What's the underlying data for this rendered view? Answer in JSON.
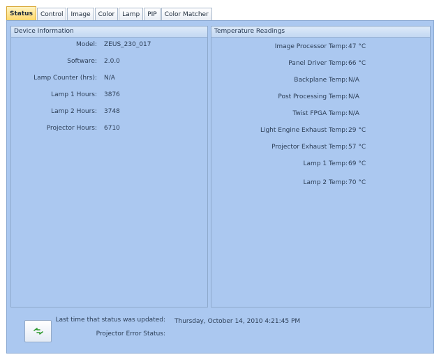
{
  "tabs": [
    {
      "label": "Status",
      "active": true
    },
    {
      "label": "Control",
      "active": false
    },
    {
      "label": "Image",
      "active": false
    },
    {
      "label": "Color",
      "active": false
    },
    {
      "label": "Lamp",
      "active": false
    },
    {
      "label": "PIP",
      "active": false
    },
    {
      "label": "Color Matcher",
      "active": false
    }
  ],
  "device_info": {
    "header": "Device Information",
    "rows": [
      {
        "label": "Model:",
        "value": "ZEUS_230_017"
      },
      {
        "label": "Software:",
        "value": "2.0.0"
      },
      {
        "label": "Lamp Counter (hrs):",
        "value": "N/A"
      },
      {
        "label": "Lamp 1 Hours:",
        "value": "3876"
      },
      {
        "label": "Lamp 2 Hours:",
        "value": "3748"
      },
      {
        "label": "Projector Hours:",
        "value": "6710"
      }
    ]
  },
  "temperature": {
    "header": "Temperature Readings",
    "rows": [
      {
        "label": "Image Processor Temp:",
        "value": "47 °C"
      },
      {
        "label": "Panel Driver Temp:",
        "value": "66 °C"
      },
      {
        "label": "Backplane Temp:",
        "value": "N/A"
      },
      {
        "label": "Post Processing Temp:",
        "value": "N/A"
      },
      {
        "label": "Twist FPGA Temp:",
        "value": "N/A"
      },
      {
        "label": "Light Engine Exhaust Temp:",
        "value": "29 °C"
      },
      {
        "label": "Projector Exhaust Temp:",
        "value": "57 °C"
      },
      {
        "label": "Lamp 1 Temp:",
        "value": "69 °C"
      },
      {
        "label": "Lamp 2 Temp:",
        "value": "70 °C"
      }
    ]
  },
  "footer": {
    "last_updated_label": "Last time that status was updated:",
    "last_updated_value": "Thursday, October 14, 2010 4:21:45 PM",
    "error_status_label": "Projector Error Status:",
    "error_status_value": ""
  },
  "icons": {
    "refresh_button_icon": "refresh-arrows-icon"
  },
  "colors": {
    "panel_background": "#abc8f0",
    "active_tab": "#ffd96b",
    "refresh_icon": "#2e9a2e"
  }
}
